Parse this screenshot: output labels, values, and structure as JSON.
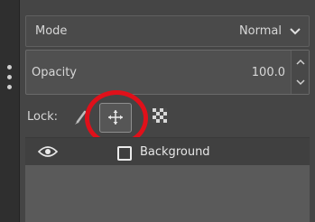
{
  "mode": {
    "label": "Mode",
    "value": "Normal"
  },
  "opacity": {
    "label": "Opacity",
    "value": "100.0"
  },
  "lock": {
    "label": "Lock:"
  },
  "layers": [
    {
      "name": "Background"
    }
  ],
  "colors": {
    "highlight": "#e0101a",
    "panel": "#454545"
  },
  "icons": [
    "grip-dots-icon",
    "chevron-down-icon",
    "spin-up-icon",
    "spin-down-icon",
    "paintbrush-icon",
    "move-icon",
    "checkerboard-icon",
    "eye-icon"
  ]
}
